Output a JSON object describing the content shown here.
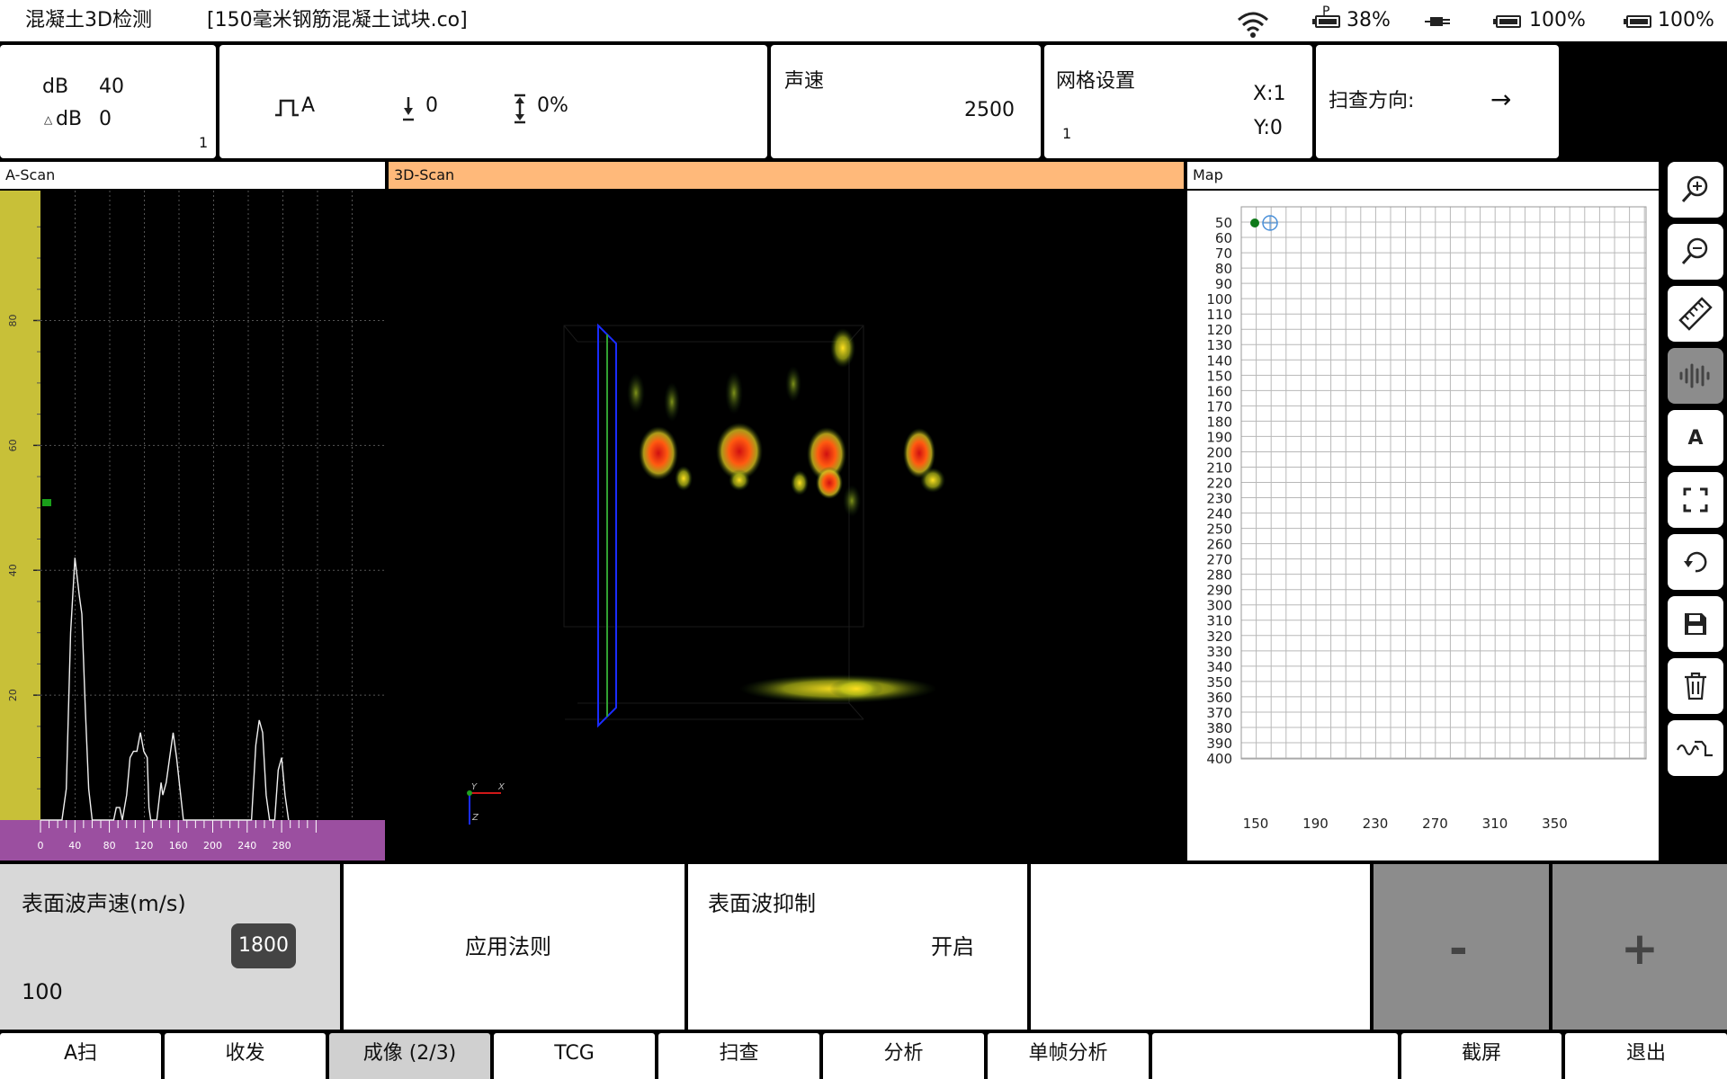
{
  "statusbar": {
    "app_title": "混凝土3D检测",
    "file_name": "[150毫米钢筋混凝土试块.co]",
    "battery_p_label": "P",
    "battery_p_level": "38%",
    "battery_1_level": "100%",
    "battery_2_level": "100%"
  },
  "gain_panel": {
    "db_label": "dB",
    "db_value": "40",
    "ddb_label": "dB",
    "ddb_value": "0",
    "index": "1"
  },
  "pulse_panel": {
    "mode": "A",
    "delay": "0",
    "reject": "0%"
  },
  "velocity_panel": {
    "label": "声速",
    "value": "2500"
  },
  "grid_panel": {
    "label": "网格设置",
    "index": "1",
    "x": "X:1",
    "y": "Y:0"
  },
  "direction_panel": {
    "label": "扫查方向:",
    "arrow": "→"
  },
  "sections": {
    "ascan_title": "A-Scan",
    "scan3d_title": "3D-Scan",
    "map_title": "Map"
  },
  "ascan": {
    "y_ticks": [
      "80",
      "60",
      "40",
      "20"
    ],
    "x_ticks": [
      "0",
      "40",
      "80",
      "120",
      "160",
      "200",
      "240",
      "280"
    ]
  },
  "scan3d": {
    "axis_x": "X",
    "axis_y": "Y",
    "axis_z": "Z"
  },
  "map": {
    "y_labels": [
      "50",
      "60",
      "70",
      "80",
      "90",
      "100",
      "110",
      "120",
      "130",
      "140",
      "150",
      "160",
      "170",
      "180",
      "190",
      "200",
      "210",
      "220",
      "230",
      "240",
      "250",
      "260",
      "270",
      "280",
      "290",
      "300",
      "310",
      "320",
      "330",
      "340",
      "350",
      "360",
      "370",
      "380",
      "390",
      "400"
    ],
    "x_labels": [
      "150",
      "190",
      "230",
      "270",
      "310",
      "350"
    ]
  },
  "tools": [
    "zoom-in-icon",
    "zoom-out-icon",
    "ruler-icon",
    "waveform-icon",
    "text-a-icon",
    "fullscreen-icon",
    "undo-icon",
    "save-icon",
    "trash-icon",
    "signal-icon"
  ],
  "tool_a_label": "A",
  "params": {
    "surface_velocity_label": "表面波声速(m/s)",
    "surface_velocity_value": "1800",
    "surface_velocity_step": "100",
    "apply_rule_label": "应用法则",
    "suppress_label": "表面波抑制",
    "suppress_value": "开启",
    "minus_label": "-",
    "plus_label": "+"
  },
  "bottom_tabs": [
    "A扫",
    "收发",
    "成像 (2/3)",
    "TCG",
    "扫查",
    "分析",
    "单帧分析",
    "",
    "截屏",
    "退出"
  ],
  "colors": {
    "yellow_ruler": "#c8c038",
    "purple_ruler": "#9b4fa0",
    "tab_active": "#ffb97a",
    "button_gray": "#8c8c8c"
  }
}
